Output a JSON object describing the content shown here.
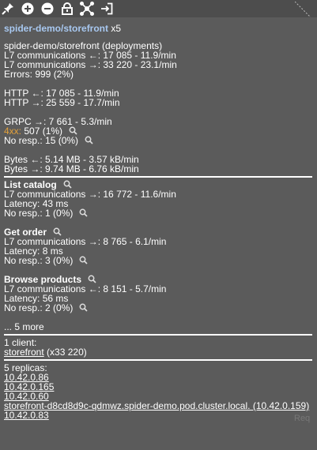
{
  "title": {
    "link": "spider-demo/storefront",
    "multiplier": "x5"
  },
  "summary": {
    "heading": "spider-demo/storefront (deployments)",
    "l7_in": "L7 communications ←:  17 085 - 11.9/min",
    "l7_out": "L7 communications →:  33 220 - 23.1/min",
    "errors": "Errors: 999 (2%)",
    "http_in": "HTTP ←:  17 085 - 11.9/min",
    "http_out": "HTTP →:  25 559 - 17.7/min",
    "grpc_out": "GRPC →:  7 661 - 5.3/min",
    "status_4xx_label": "4xx:",
    "status_4xx_value": " 507 (1%)",
    "no_resp": "No resp.: 15 (0%)",
    "bytes_in": "Bytes ←:  5.14 MB - 3.57 kB/min",
    "bytes_out": "Bytes →:  9.74 MB - 6.76 kB/min"
  },
  "endpoints": [
    {
      "name": "List catalog",
      "comm": "L7 communications →:  16 772 - 11.6/min",
      "latency": "Latency: 43 ms",
      "no_resp": "No resp.: 1 (0%)"
    },
    {
      "name": "Get order",
      "comm": "L7 communications →:  8 765 - 6.1/min",
      "latency": "Latency: 8 ms",
      "no_resp": "No resp.: 3 (0%)"
    },
    {
      "name": "Browse products",
      "comm": "L7 communications ←:  8 151 - 5.7/min",
      "latency": "Latency: 56 ms",
      "no_resp": "No resp.: 2 (0%)"
    }
  ],
  "more": "... 5 more",
  "clients": {
    "heading": "1 client:",
    "link": "storefront",
    "count": " (x33 220)"
  },
  "replicas": {
    "heading": "5 replicas:",
    "items": [
      "10.42.0.86",
      "10.42.0.165",
      "10.42.0.60",
      "storefront-d8cd8d9c-qdmwz.spider-demo.pod.cluster.local. (10.42.0.159)",
      "10.42.0.83"
    ]
  },
  "background_text": "Req",
  "toolbar_icons": [
    "pin-icon",
    "zoom-in-icon",
    "zoom-out-icon",
    "lock-icon",
    "network-icon",
    "exit-icon"
  ]
}
